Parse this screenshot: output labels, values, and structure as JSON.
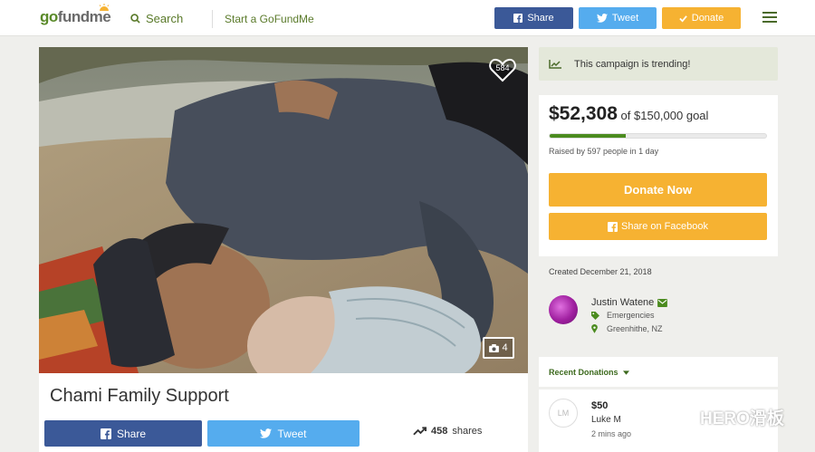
{
  "header": {
    "logo_go": "go",
    "logo_fund": "fund",
    "logo_me": "me",
    "search_label": "Search",
    "start_link": "Start a GoFundMe",
    "share_label": "Share",
    "tweet_label": "Tweet",
    "donate_label": "Donate"
  },
  "campaign": {
    "like_count": "584",
    "photo_count": "4",
    "title": "Chami Family Support",
    "share_label": "Share",
    "tweet_label": "Tweet",
    "shares_count": "458",
    "shares_suffix": "shares"
  },
  "sidebar": {
    "trending_text": "This campaign is trending!",
    "raised_amount": "$52,308",
    "goal_text": "of $150,000 goal",
    "progress_fraction": 0.35,
    "raised_by": "Raised by 597 people in 1 day",
    "donate_now": "Donate Now",
    "share_facebook": "Share on Facebook",
    "created": "Created December 21, 2018",
    "organizer_name": "Justin Watene",
    "organizer_category": "Emergencies",
    "organizer_location": "Greenhithe, NZ",
    "recent_donations_title": "Recent Donations",
    "donation": {
      "avatar_initials": "LM",
      "amount": "$50",
      "name": "Luke M",
      "time": "2 mins ago"
    }
  },
  "watermark": "HERO滑板",
  "colors": {
    "facebook": "#3b5998",
    "twitter": "#55acee",
    "donate": "#f6b232",
    "brand_green": "#4b8b1f"
  }
}
